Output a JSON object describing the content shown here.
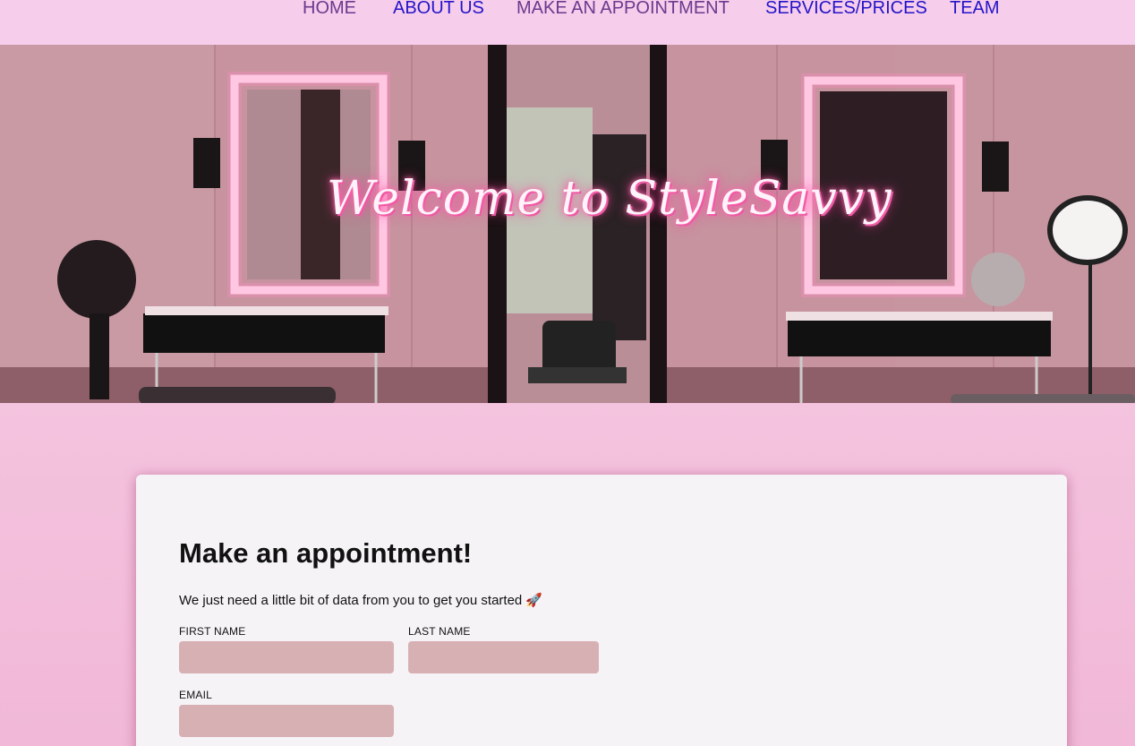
{
  "nav": {
    "items": [
      {
        "label": "HOME"
      },
      {
        "label": "ABOUT US"
      },
      {
        "label": "MAKE AN APPOINTMENT"
      },
      {
        "label": "SERVICES/PRICES"
      },
      {
        "label": "TEAM"
      }
    ]
  },
  "hero": {
    "title": "Welcome to StyleSavvy"
  },
  "form": {
    "heading": "Make an appointment!",
    "intro": "We just need a little bit of data from you to get you started 🚀",
    "first_name_label": "FIRST NAME",
    "last_name_label": "LAST NAME",
    "email_label": "EMAIL",
    "first_name_value": "",
    "last_name_value": "",
    "email_value": ""
  },
  "colors": {
    "nav_bg": "#f6cdeb",
    "nav_link": "#2414c9",
    "nav_visited": "#6a3a8e",
    "page_bg": "#f3c1de",
    "card_bg": "#f6f3f7",
    "input_bg": "#d7b0b4"
  }
}
